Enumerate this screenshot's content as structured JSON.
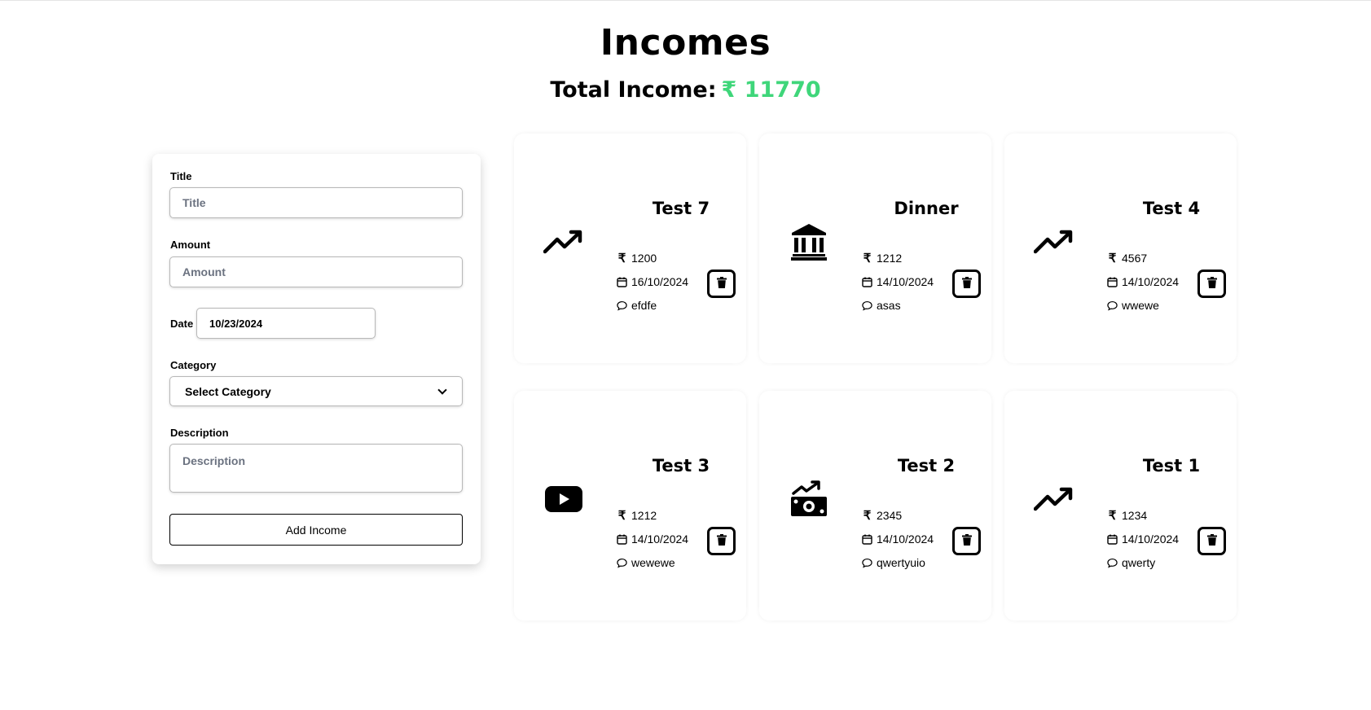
{
  "header": {
    "title": "Incomes",
    "total_label": "Total Income:",
    "total_value": "₹ 11770",
    "accent_color": "#3fd67a"
  },
  "form": {
    "title_label": "Title",
    "title_placeholder": "Title",
    "amount_label": "Amount",
    "amount_placeholder": "Amount",
    "date_label": "Date",
    "date_value": "10/23/2024",
    "category_label": "Category",
    "category_selected": "Select Category",
    "description_label": "Description",
    "description_placeholder": "Description",
    "submit_label": "Add Income"
  },
  "incomes": [
    {
      "title": "Test 7",
      "icon": "trending-up-icon",
      "amount": "1200",
      "date": "16/10/2024",
      "description": "efdfe"
    },
    {
      "title": "Dinner",
      "icon": "bank-icon",
      "amount": "1212",
      "date": "14/10/2024",
      "description": "asas"
    },
    {
      "title": "Test 4",
      "icon": "trending-up-icon",
      "amount": "4567",
      "date": "14/10/2024",
      "description": "wwewe"
    },
    {
      "title": "Test 3",
      "icon": "youtube-icon",
      "amount": "1212",
      "date": "14/10/2024",
      "description": "wewewe"
    },
    {
      "title": "Test 2",
      "icon": "money-growth-icon",
      "amount": "2345",
      "date": "14/10/2024",
      "description": "qwertyuio"
    },
    {
      "title": "Test 1",
      "icon": "trending-up-icon",
      "amount": "1234",
      "date": "14/10/2024",
      "description": "qwerty"
    }
  ],
  "currency_symbol": "₹"
}
